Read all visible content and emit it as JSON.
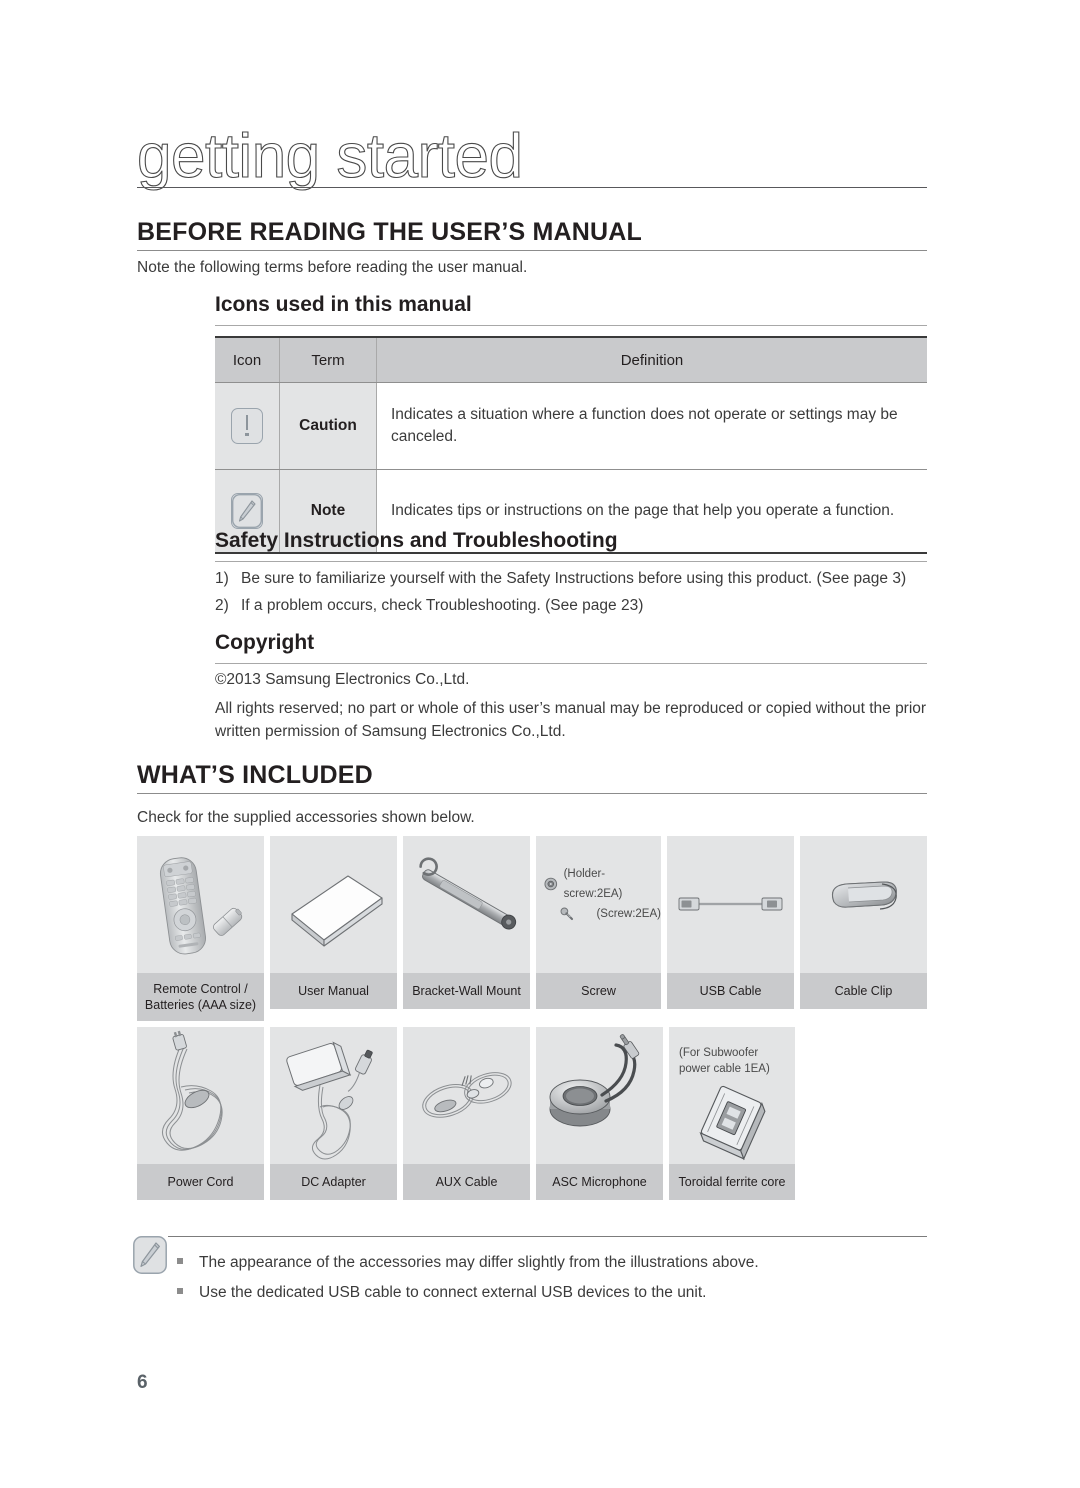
{
  "page": {
    "title": "getting started",
    "number": "6"
  },
  "section_before_reading": {
    "heading": "BEFORE READING THE USER’S MANUAL",
    "intro": "Note the following terms before reading the user manual."
  },
  "icons_subsection": {
    "heading": "Icons used in this manual",
    "table": {
      "headers": [
        "Icon",
        "Term",
        "Definition"
      ],
      "rows": [
        {
          "icon": "caution-icon",
          "term": "Caution",
          "definition": "Indicates a situation where a function does not operate or settings may be canceled."
        },
        {
          "icon": "note-icon",
          "term": "Note",
          "definition": "Indicates tips or instructions on the page that help you operate a function."
        }
      ]
    }
  },
  "safety_subsection": {
    "heading": "Safety Instructions and Troubleshooting",
    "items": [
      {
        "num": "1)",
        "text": "Be sure to familiarize yourself with the Safety Instructions before using this product. (See page 3)"
      },
      {
        "num": "2)",
        "text": "If a problem occurs, check Troubleshooting. (See page 23)"
      }
    ]
  },
  "copyright_subsection": {
    "heading": "Copyright",
    "line1": "©2013 Samsung Electronics Co.,Ltd.",
    "line2": "All rights reserved; no part or whole of this user’s manual may be reproduced or copied without the prior",
    "line3": "written permission of Samsung Electronics Co.,Ltd."
  },
  "section_whats_included": {
    "heading": "WHAT’S INCLUDED",
    "intro": "Check for the supplied accessories shown below."
  },
  "accessories": {
    "row1": [
      {
        "label_line1": "Remote Control /",
        "label_line2": "Batteries (AAA size)",
        "icon": "remote-control-icon"
      },
      {
        "label_line1": "User Manual",
        "label_line2": "",
        "icon": "user-manual-icon"
      },
      {
        "label_line1": "Bracket-Wall Mount",
        "label_line2": "",
        "icon": "bracket-wall-mount-icon"
      },
      {
        "label_line1": "Screw",
        "label_line2": "",
        "icon": "screw-icon",
        "note1": "(Holder-screw:2EA)",
        "note2": "(Screw:2EA)"
      },
      {
        "label_line1": "USB Cable",
        "label_line2": "",
        "icon": "usb-cable-icon"
      },
      {
        "label_line1": "Cable Clip",
        "label_line2": "",
        "icon": "cable-clip-icon"
      }
    ],
    "row2": [
      {
        "label_line1": "Power Cord",
        "label_line2": "",
        "icon": "power-cord-icon"
      },
      {
        "label_line1": "DC Adapter",
        "label_line2": "",
        "icon": "dc-adapter-icon"
      },
      {
        "label_line1": "AUX Cable",
        "label_line2": "",
        "icon": "aux-cable-icon"
      },
      {
        "label_line1": "ASC Microphone",
        "label_line2": "",
        "icon": "asc-microphone-icon"
      },
      {
        "label_line1": "Toroidal ferrite core",
        "label_line2": "",
        "icon": "ferrite-core-icon",
        "note1": "(For Subwoofer",
        "note2": "power cable 1EA)"
      }
    ]
  },
  "footer_notes": {
    "icon": "note-icon",
    "items": [
      "The appearance of the accessories may differ slightly from the illustrations above.",
      "Use the dedicated USB cable to connect external USB devices to the unit."
    ]
  },
  "colors": {
    "text": "#231f20",
    "body_text": "#3b3b3b",
    "table_header_bg": "#c9cacc",
    "cell_bg": "#e3e4e5",
    "page_number": "#5a6268"
  }
}
